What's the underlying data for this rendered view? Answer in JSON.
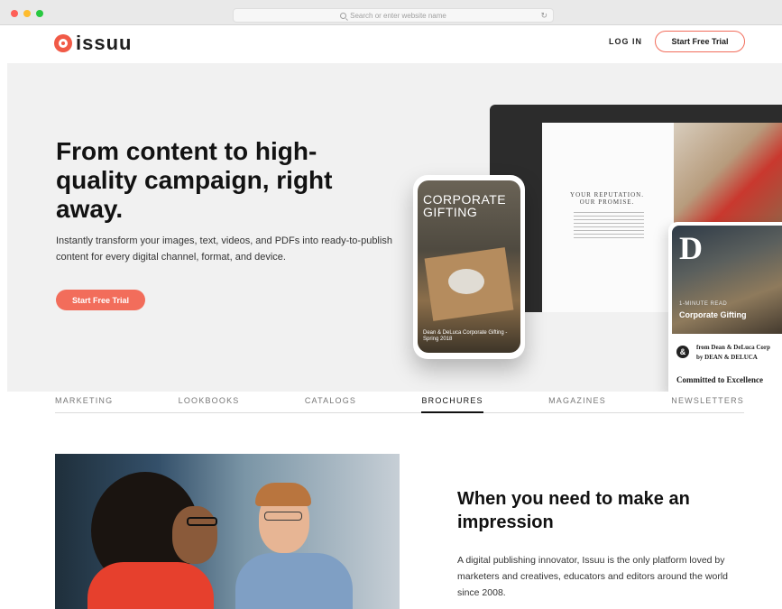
{
  "browser": {
    "url_placeholder": "Search or enter website name"
  },
  "header": {
    "logo_text": "issuu",
    "login_label": "LOG IN",
    "trial_label": "Start Free Trial"
  },
  "hero": {
    "title": "From content to high-quality campaign, right away.",
    "subtitle": "Instantly transform your images, text, videos, and PDFs into ready-to-publish content for every digital channel, format, and device.",
    "cta_label": "Start Free Trial",
    "laptop": {
      "heading": "YOUR REPUTATION. OUR PROMISE."
    },
    "phone": {
      "title": "CORPORATE GIFTING",
      "caption": "Dean & DeLuca Corporate Gifting - Spring 2018"
    },
    "card": {
      "meta": "1-MINUTE READ",
      "title": "Corporate Gifting",
      "from_line": "from Dean & DeLuca Corp",
      "by_line": "by DEAN & DELUCA",
      "headline": "Committed to Excellence"
    }
  },
  "tabs": [
    {
      "label": "MARKETING"
    },
    {
      "label": "LOOKBOOKS"
    },
    {
      "label": "CATALOGS"
    },
    {
      "label": "BROCHURES"
    },
    {
      "label": "MAGAZINES"
    },
    {
      "label": "NEWSLETTERS"
    }
  ],
  "active_tab": "BROCHURES",
  "lower": {
    "title": "When you need to make an impression",
    "subtitle": "A digital publishing innovator, Issuu is the only platform loved by marketers and creatives, educators and editors around the world since 2008."
  },
  "colors": {
    "accent": "#f26d5b",
    "hero_bg": "#f1f1f1"
  }
}
